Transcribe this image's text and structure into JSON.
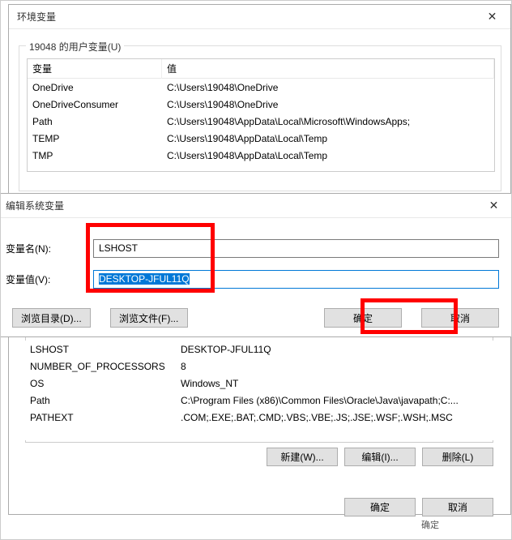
{
  "parentDialog": {
    "title": "环境变量",
    "closeGlyph": "✕",
    "userGroupLegend": "19048 的用户变量(U)",
    "columns": {
      "name": "变量",
      "value": "值"
    },
    "userVars": [
      {
        "name": "OneDrive",
        "value": "C:\\Users\\19048\\OneDrive"
      },
      {
        "name": "OneDriveConsumer",
        "value": "C:\\Users\\19048\\OneDrive"
      },
      {
        "name": "Path",
        "value": "C:\\Users\\19048\\AppData\\Local\\Microsoft\\WindowsApps;"
      },
      {
        "name": "TEMP",
        "value": "C:\\Users\\19048\\AppData\\Local\\Temp"
      },
      {
        "name": "TMP",
        "value": "C:\\Users\\19048\\AppData\\Local\\Temp"
      }
    ],
    "sysVars": [
      {
        "name": "LSHOST",
        "value": "DESKTOP-JFUL11Q"
      },
      {
        "name": "NUMBER_OF_PROCESSORS",
        "value": "8"
      },
      {
        "name": "OS",
        "value": "Windows_NT"
      },
      {
        "name": "Path",
        "value": "C:\\Program Files (x86)\\Common Files\\Oracle\\Java\\javapath;C:..."
      },
      {
        "name": "PATHEXT",
        "value": ".COM;.EXE;.BAT;.CMD;.VBS;.VBE;.JS;.JSE;.WSF;.WSH;.MSC"
      }
    ],
    "sysButtons": {
      "new": "新建(W)...",
      "edit": "编辑(I)...",
      "del": "删除(L)"
    },
    "dlgButtons": {
      "ok": "确定",
      "cancel": "取消"
    },
    "dlgSubOk": "确定"
  },
  "editDialog": {
    "title": "编辑系统变量",
    "closeGlyph": "✕",
    "nameLabel": "变量名(N):",
    "valueLabel": "变量值(V):",
    "nameValue": "LSHOST",
    "valueValue": "DESKTOP-JFUL11Q",
    "browseDir": "浏览目录(D)...",
    "browseFile": "浏览文件(F)...",
    "ok": "确定",
    "cancel": "取消"
  },
  "highlightColor": "#ff0000"
}
